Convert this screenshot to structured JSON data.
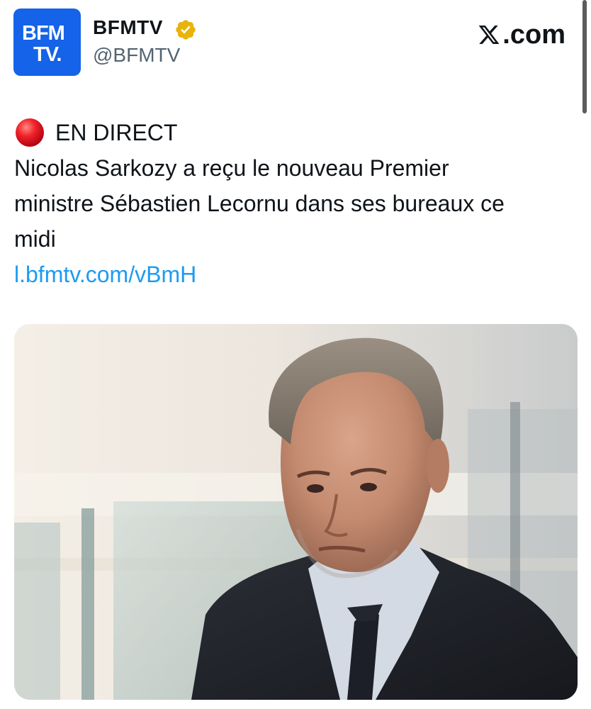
{
  "header": {
    "avatar_line1": "BFM",
    "avatar_line2": "TV.",
    "display_name": "BFMTV",
    "handle": "@BFMTV",
    "brand_suffix": ".com",
    "brand_icon": "x-logo-icon",
    "verified_icon": "verified-badge-icon",
    "verified_color": "#e8b40c"
  },
  "tweet": {
    "live_icon": "red-circle-icon",
    "live_label": "EN DIRECT",
    "lines": [
      "Nicolas Sarkozy a reçu le nouveau Premier",
      "ministre Sébastien Lecornu dans ses bureaux ce",
      "midi"
    ],
    "link": "l.bfmtv.com/vBmH"
  },
  "media": {
    "description_icon": "photo-of-man-in-suit"
  },
  "colors": {
    "accent_blue": "#1d9bf0",
    "brand_blue": "#1463e8",
    "text": "#0f1419",
    "secondary_text": "#536471",
    "live_red": "#e0131d"
  }
}
